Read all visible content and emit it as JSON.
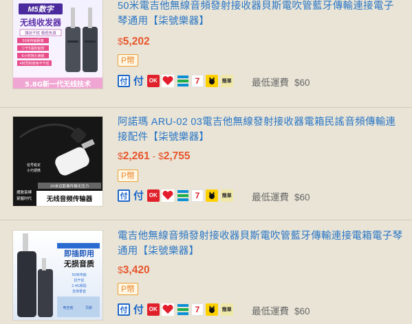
{
  "products": [
    {
      "title": "50米電吉他無線音頻發射接收器貝斯電吹管藍牙傳輸連接電子琴通用【柒號樂器】",
      "price_currency": "$",
      "price": "5,202",
      "price_max": null,
      "badge": "P幣",
      "shipping_label": "最低運費",
      "shipping_value": "$60",
      "image_text": [
        "M5数字",
        "无线收发器",
        "强抗干扰 极低失真",
        "50米传输距离",
        "少于5毫秒延时",
        "6小时持久续航",
        "4时同时使用不干扰",
        "5.8G新一代无线技术"
      ]
    },
    {
      "title": "阿諾瑪 ARU-02 03電吉他無線發射接收器電箱民謠音頻傳輸連接配件【柒號樂器】",
      "price_currency": "$",
      "price": "2,261",
      "price_max": "2,755",
      "badge": "P幣",
      "shipping_label": "最低運費",
      "shipping_value": "$60",
      "image_text": [
        "信号稳定",
        "小巧便携",
        "20米远距离传输无压力",
        "摆脱束缚",
        "紧握时代",
        "无线音频传输器"
      ]
    },
    {
      "title": "電吉他無線音頻發射接收器貝斯電吹管藍牙傳輸連接電箱電子琴通用【柒號樂器】",
      "price_currency": "$",
      "price": "3,420",
      "price_max": null,
      "badge": "P幣",
      "shipping_label": "最低運費",
      "shipping_value": "$60",
      "image_text": [
        "即插即用",
        "无损音质",
        "50米传输",
        "抗干扰",
        "2.4G频段",
        "支持录音",
        "电吉他",
        "贝斯"
      ]
    }
  ],
  "pay_icons": [
    {
      "name": "fu-icon",
      "label": "付"
    },
    {
      "name": "fu-alt-icon",
      "label": "付"
    },
    {
      "name": "ok-mart-icon",
      "label": "OK"
    },
    {
      "name": "hilife-icon",
      "label": ""
    },
    {
      "name": "familymart-icon",
      "label": ""
    },
    {
      "name": "seven-eleven-icon",
      "label": "7"
    },
    {
      "name": "black-cat-icon",
      "label": ""
    },
    {
      "name": "simple-pay-icon",
      "label": "簡單"
    }
  ],
  "colors": {
    "background": "#e9e4d6",
    "title": "#2a76c6",
    "price": "#e8542a",
    "badge": "#e8872a",
    "muted": "#666666"
  }
}
